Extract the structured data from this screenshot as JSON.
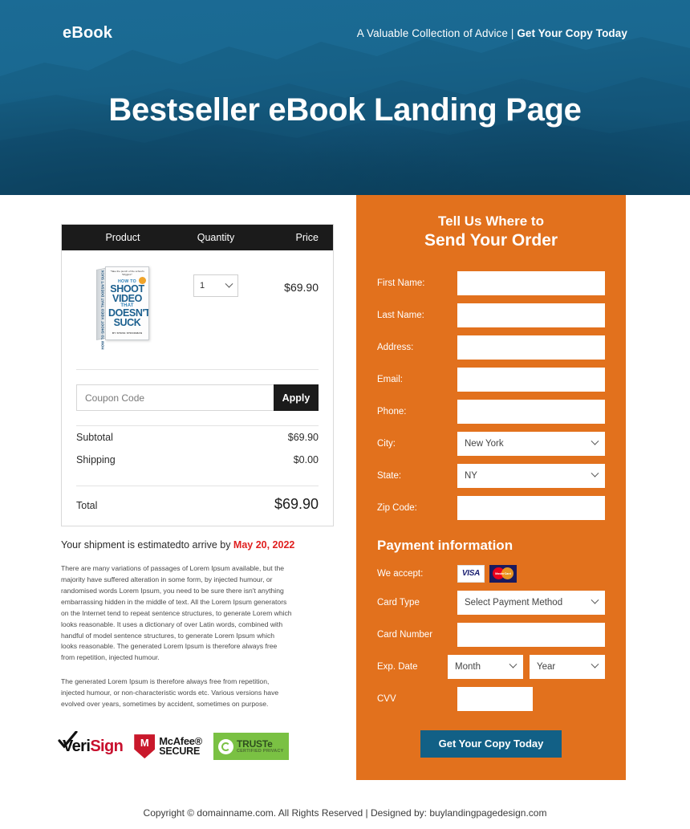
{
  "hero": {
    "brand": "eBook",
    "tagline_plain": "A Valuable Collection of Advice | ",
    "tagline_bold": "Get Your Copy Today",
    "title": "Bestseller eBook Landing Page",
    "bg_color": "#175f86"
  },
  "cart": {
    "headers": {
      "product": "Product",
      "quantity": "Quantity",
      "price": "Price"
    },
    "item": {
      "quantity_value": "1",
      "price": "$69.90",
      "book": {
        "blurb": "\"Take the punch of the school's 'Wiggins'\"",
        "howto": "HOW TO",
        "line1": "SHOOT",
        "line2": "VIDEO",
        "that": "THAT",
        "line3": "DOESN'T",
        "line4": "SUCK",
        "author": "BY STEVE STOCKMAN",
        "spine": "HOW TO SHOOT VIDEO THAT DOESN'T SUCK"
      }
    },
    "coupon_placeholder": "Coupon Code",
    "coupon_value": "",
    "apply_label": "Apply",
    "subtotal_label": "Subtotal",
    "subtotal_value": "$69.90",
    "shipping_label": "Shipping",
    "shipping_value": "$0.00",
    "total_label": "Total",
    "total_value": "$69.90"
  },
  "shipment": {
    "text": "Your shipment is estimatedto arrive by ",
    "date": "May 20, 2022",
    "date_color": "#e02020"
  },
  "paragraphs": {
    "p1": "There are many variations of passages of Lorem Ipsum available, but the majority have suffered alteration in some form, by injected humour, or randomised words Lorem Ipsum, you need to be sure there isn't anything embarrassing hidden in the middle of text. All the Lorem Ipsum generators on the Internet tend to repeat sentence structures, to generate Lorem which looks reasonable. It uses a dictionary of over Latin words, combined with handful of model sentence structures, to generate Lorem Ipsum which looks reasonable. The generated Lorem Ipsum is therefore always free from repetition, injected humour.",
    "p2": "The generated Lorem Ipsum is therefore always free from repetition, injected humour, or non-characteristic words etc. Various versions have evolved over years, sometimes by accident, sometimes on purpose."
  },
  "badges": {
    "verisign_veri": "Veri",
    "verisign_sign": "Sign",
    "mcafee_l1": "McAfee®",
    "mcafee_l2": "SECURE",
    "mcafee_m": "M",
    "truste_l1": "TRUSTe",
    "truste_l2": "CERTIFIED PRIVACY"
  },
  "order": {
    "title_l1": "Tell Us Where to",
    "title_l2": "Send Your Order",
    "panel_color": "#e2711d",
    "fields": [
      {
        "label": "First Name:",
        "type": "input",
        "value": "",
        "name": "first-name"
      },
      {
        "label": "Last Name:",
        "type": "input",
        "value": "",
        "name": "last-name"
      },
      {
        "label": "Address:",
        "type": "input",
        "value": "",
        "name": "address"
      },
      {
        "label": "Email:",
        "type": "input",
        "value": "",
        "name": "email"
      },
      {
        "label": "Phone:",
        "type": "input",
        "value": "",
        "name": "phone"
      },
      {
        "label": "City:",
        "type": "select",
        "value": "New York",
        "name": "city"
      },
      {
        "label": "State:",
        "type": "select",
        "value": "NY",
        "name": "state"
      },
      {
        "label": "Zip Code:",
        "type": "input",
        "value": "",
        "name": "zip-code"
      }
    ],
    "payment": {
      "title": "Payment information",
      "we_accept_label": "We accept:",
      "cards": [
        "VISA",
        "MasterCard"
      ],
      "visa_text": "VISA",
      "mc_text": "MasterCard",
      "card_type_label": "Card Type",
      "card_type_value": "Select Payment Method",
      "card_number_label": "Card Number",
      "card_number_value": "",
      "exp_label": "Exp. Date",
      "exp_month_value": "Month",
      "exp_year_value": "Year",
      "cvv_label": "CVV",
      "cvv_value": ""
    },
    "cta_label": "Get Your Copy Today",
    "cta_color": "#126086"
  },
  "footer": {
    "text": "Copyright © domainname.com. All Rights Reserved | Designed by: buylandingpagedesign.com"
  }
}
